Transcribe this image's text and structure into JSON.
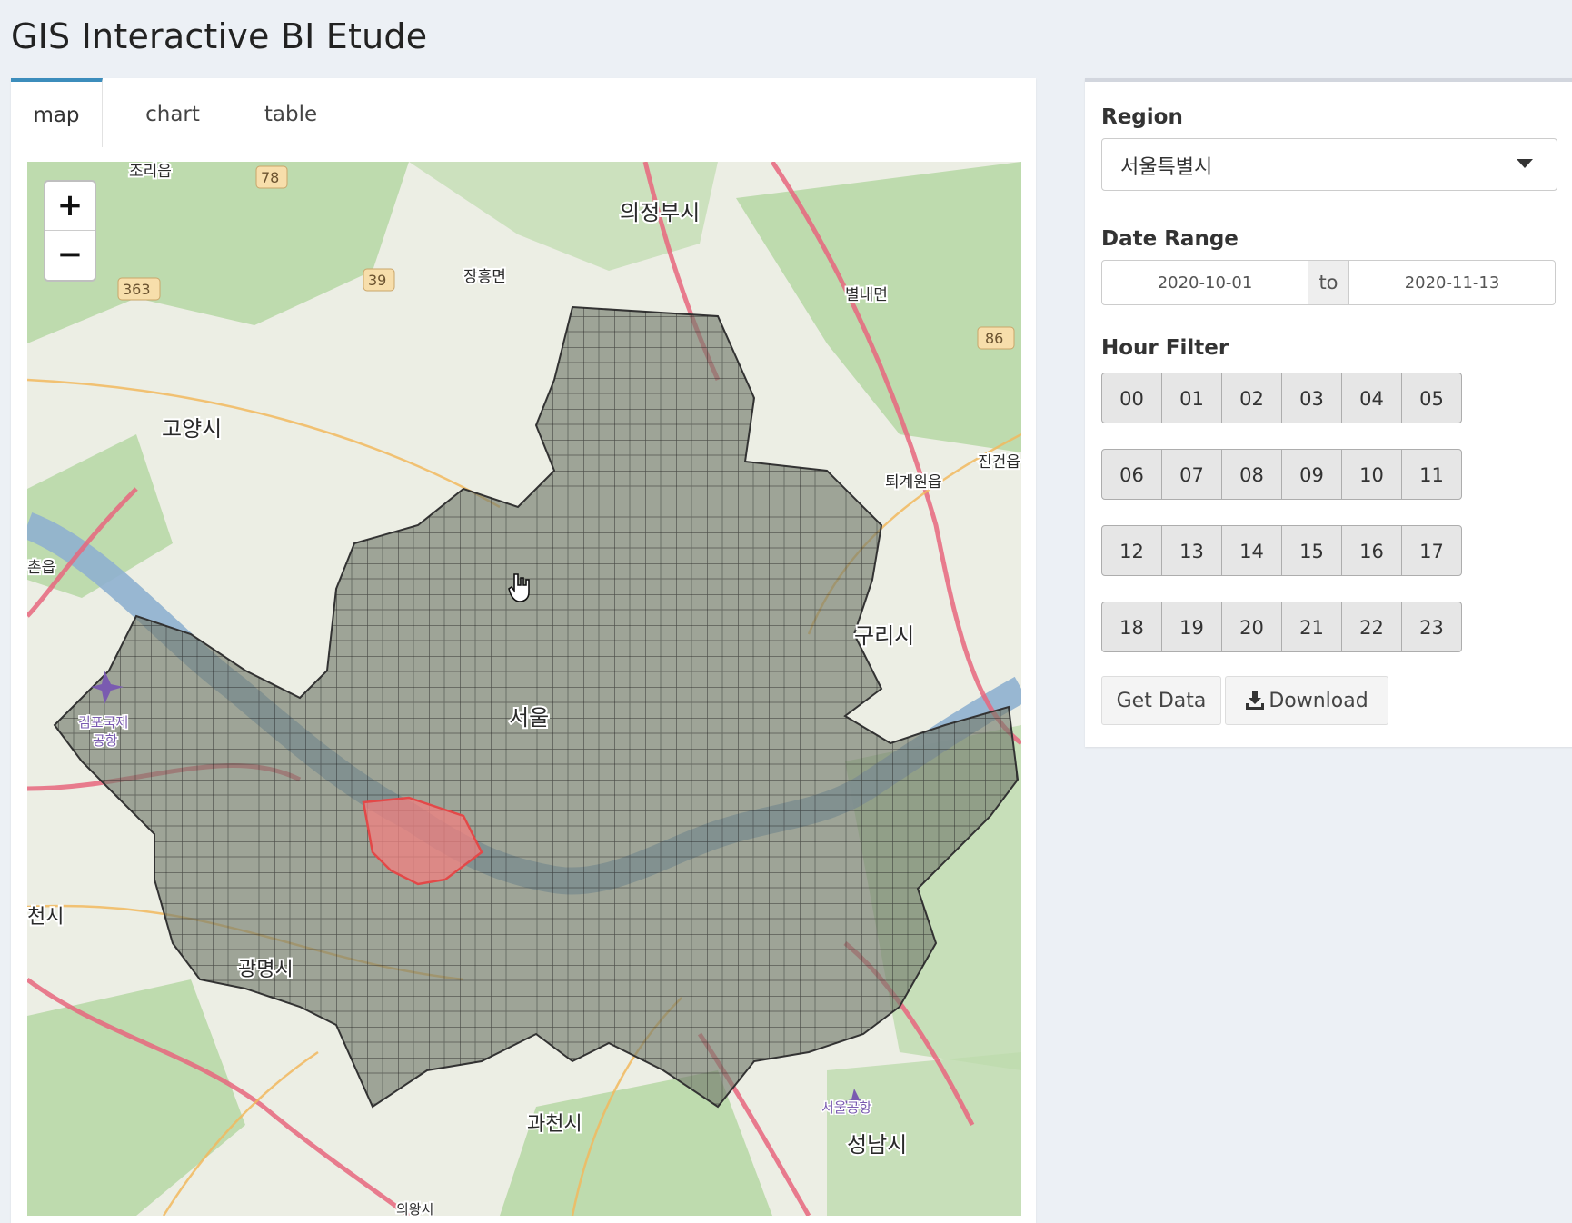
{
  "header": {
    "title": "GIS Interactive BI Etude"
  },
  "tabs": [
    {
      "label": "map",
      "active": true
    },
    {
      "label": "chart",
      "active": false
    },
    {
      "label": "table",
      "active": false
    }
  ],
  "map": {
    "zoom_in": "+",
    "zoom_out": "−",
    "labels": {
      "uijeongbu": "의정부시",
      "goyang": "고양시",
      "seoul": "서울",
      "guri": "구리시",
      "gwangmyeong": "광명시",
      "gwacheon": "과천시",
      "seongnam": "성남시",
      "gimpo_airport": "김포국제",
      "gimpo_airport2": "공항",
      "seoul_airport": "서울공항",
      "jangheung": "장흥면",
      "byeolnae": "별내면",
      "toegyewon": "퇴계원읍",
      "jinjeon": "진건읍",
      "jori": "조리읍",
      "bucheon": "천시",
      "chondeul": "촌읍",
      "uiwang": "의왕시"
    },
    "route_shields": [
      "78",
      "39",
      "363",
      "86"
    ],
    "highlight_color": "#f08080",
    "district_fill": "#707a6a"
  },
  "sidebar": {
    "region_label": "Region",
    "region_value": "서울특별시",
    "date_label": "Date Range",
    "date_start": "2020-10-01",
    "date_sep": "to",
    "date_end": "2020-11-13",
    "hour_label": "Hour Filter",
    "hours": [
      [
        "00",
        "01",
        "02",
        "03",
        "04",
        "05"
      ],
      [
        "06",
        "07",
        "08",
        "09",
        "10",
        "11"
      ],
      [
        "12",
        "13",
        "14",
        "15",
        "16",
        "17"
      ],
      [
        "18",
        "19",
        "20",
        "21",
        "22",
        "23"
      ]
    ],
    "get_data_label": "Get Data",
    "download_label": "Download",
    "download_icon": "download-icon"
  }
}
